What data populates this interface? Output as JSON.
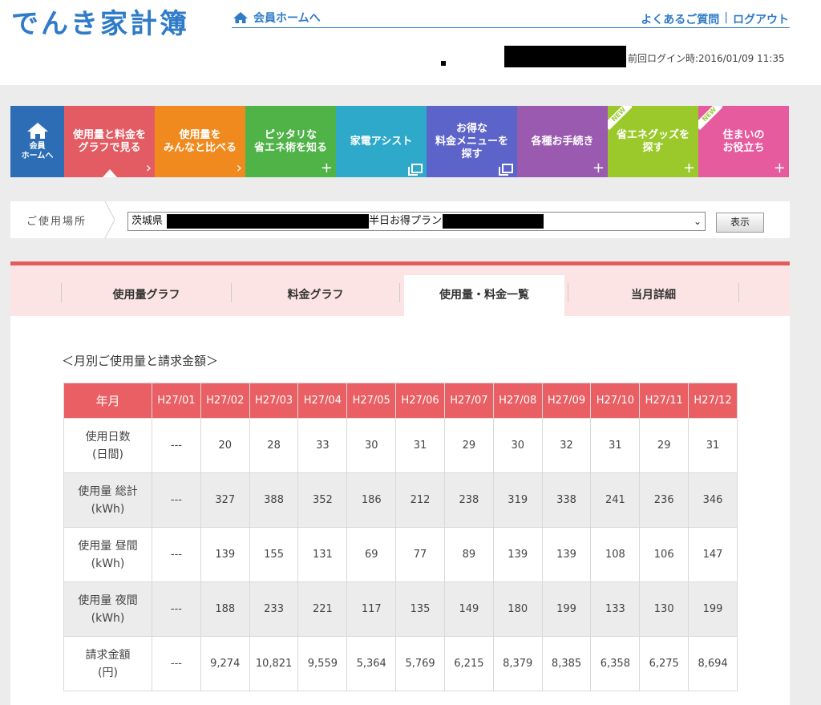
{
  "header": {
    "logo": "でんき家計簿",
    "home_link": "会員ホームへ",
    "faq_link": "よくあるご質問",
    "separator": "|",
    "logout_link": "ログアウト",
    "last_login": "前回ログイン時:2016/01/09 11:35"
  },
  "nav": {
    "home_label": "会員\nホームへ",
    "items": [
      {
        "label": "使用量と料金を\nグラフで見る",
        "color": "#e35c63",
        "icon": "chevron-right"
      },
      {
        "label": "使用量を\nみんなと比べる",
        "color": "#f08a1f",
        "icon": "chevron-right"
      },
      {
        "label": "ピッタリな\n省エネ術を知る",
        "color": "#4fb347",
        "icon": "plus"
      },
      {
        "label": "家電アシスト",
        "color": "#2fa9c9",
        "icon": "window"
      },
      {
        "label": "お得な\n料金メニューを\n探す",
        "color": "#5c63c9",
        "icon": "window"
      },
      {
        "label": "各種お手続き",
        "color": "#9a5ab0",
        "icon": "plus"
      },
      {
        "label": "省エネグッズを\n探す",
        "color": "#9bc92b",
        "icon": "plus",
        "badge": "NEW"
      },
      {
        "label": "住まいの\nお役立ち",
        "color": "#e65b9e",
        "icon": "plus",
        "badge": "NEW"
      }
    ]
  },
  "location": {
    "label": "ご使用場所",
    "address_prefix": "茨城県",
    "plan_text": "半日お得プラン",
    "show_button": "表示"
  },
  "tabs": [
    "使用量グラフ",
    "料金グラフ",
    "使用量・料金一覧",
    "当月詳細"
  ],
  "active_tab": 2,
  "section_title": "＜月別ご使用量と請求金額＞",
  "table": {
    "header_label": "年月",
    "months": [
      "H27/01",
      "H27/02",
      "H27/03",
      "H27/04",
      "H27/05",
      "H27/06",
      "H27/07",
      "H27/08",
      "H27/09",
      "H27/10",
      "H27/11",
      "H27/12"
    ],
    "rows": [
      {
        "label": "使用日数\n(日間)",
        "values": [
          "---",
          "20",
          "28",
          "33",
          "30",
          "31",
          "29",
          "30",
          "32",
          "31",
          "29",
          "31"
        ]
      },
      {
        "label": "使用量 総計\n(kWh)",
        "values": [
          "---",
          "327",
          "388",
          "352",
          "186",
          "212",
          "238",
          "319",
          "338",
          "241",
          "236",
          "346"
        ]
      },
      {
        "label": "使用量 昼間\n(kWh)",
        "values": [
          "---",
          "139",
          "155",
          "131",
          "69",
          "77",
          "89",
          "139",
          "139",
          "108",
          "106",
          "147"
        ]
      },
      {
        "label": "使用量 夜間\n(kWh)",
        "values": [
          "---",
          "188",
          "233",
          "221",
          "117",
          "135",
          "149",
          "180",
          "199",
          "133",
          "130",
          "199"
        ]
      },
      {
        "label": "請求金額\n(円)",
        "values": [
          "---",
          "9,274",
          "10,821",
          "9,559",
          "5,364",
          "5,769",
          "6,215",
          "8,379",
          "8,385",
          "6,358",
          "6,275",
          "8,694"
        ]
      }
    ]
  }
}
